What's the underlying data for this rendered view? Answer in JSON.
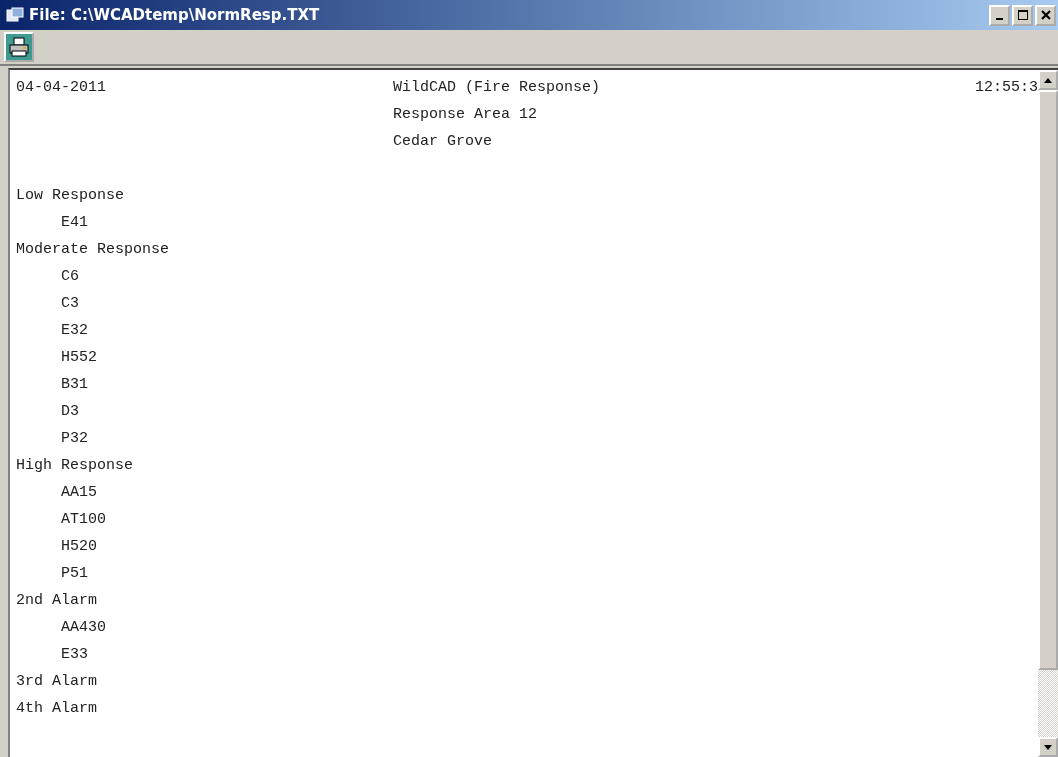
{
  "window": {
    "title": "File: C:\\WCADtemp\\NormResp.TXT"
  },
  "report": {
    "date": "04-04-2011",
    "title_lines": [
      "WildCAD (Fire Response)",
      "Response Area 12",
      "Cedar Grove"
    ],
    "time": "12:55:3",
    "sections": [
      {
        "heading": "Low Response",
        "units": [
          "E41"
        ]
      },
      {
        "heading": "Moderate Response",
        "units": [
          "C6",
          "C3",
          "E32",
          "H552",
          "B31",
          "D3",
          "P32"
        ]
      },
      {
        "heading": "High Response",
        "units": [
          "AA15",
          "AT100",
          "H520",
          "P51"
        ]
      },
      {
        "heading": "2nd Alarm",
        "units": [
          "AA430",
          "E33"
        ]
      },
      {
        "heading": "3rd Alarm"
      },
      {
        "heading": "4th Alarm"
      }
    ]
  }
}
